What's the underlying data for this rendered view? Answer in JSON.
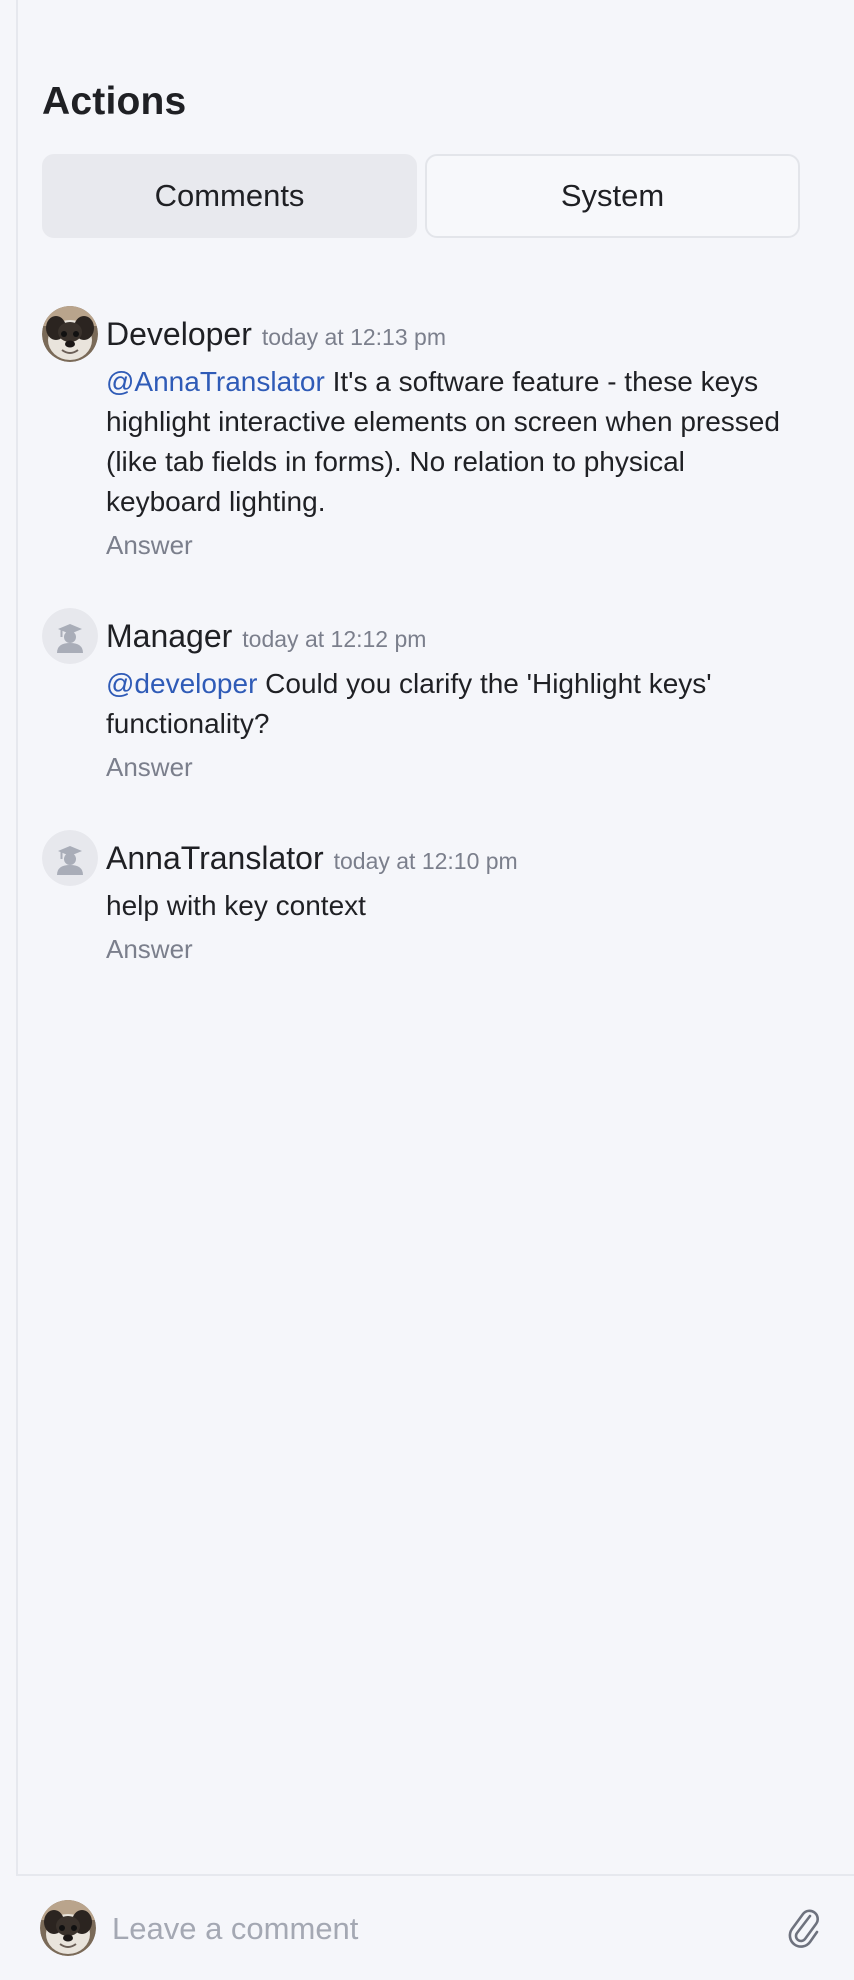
{
  "header": {
    "title": "Actions"
  },
  "tabs": [
    {
      "label": "Comments",
      "active": true
    },
    {
      "label": "System",
      "active": false
    }
  ],
  "comments": [
    {
      "author": "Developer",
      "time": "today at 12:13 pm",
      "mention": "@AnnaTranslator",
      "text": " It's a software feature - these keys highlight interactive elements on screen when pressed (like tab fields in forms). No relation to physical keyboard lighting.",
      "answer_label": "Answer",
      "avatar": "dog-photo-avatar"
    },
    {
      "author": "Manager",
      "time": "today at 12:12 pm",
      "mention": "@developer",
      "text": " Could you clarify the 'Highlight keys' functionality?",
      "answer_label": "Answer",
      "avatar": "graduate-placeholder-avatar"
    },
    {
      "author": "AnnaTranslator",
      "time": "today at 12:10 pm",
      "mention": "",
      "text": "help with key context",
      "answer_label": "Answer",
      "avatar": "graduate-placeholder-avatar"
    }
  ],
  "composer": {
    "placeholder": "Leave a comment",
    "attach_icon": "paperclip-icon"
  },
  "colors": {
    "background": "#f5f6fa",
    "mention": "#2f5bb7",
    "muted": "#7b7f8c",
    "active_tab": "#e8e9ee"
  }
}
